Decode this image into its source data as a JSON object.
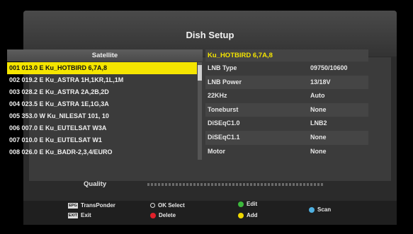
{
  "title": "Dish Setup",
  "satellite_panel": {
    "header": "Satellite",
    "items": [
      {
        "label": "001 013.0 E  Ku_HOTBIRD 6,7A,8",
        "selected": true
      },
      {
        "label": "002 019.2 E  Ku_ASTRA 1H,1KR,1L,1M",
        "selected": false
      },
      {
        "label": "003 028.2 E  Ku_ASTRA 2A,2B,2D",
        "selected": false
      },
      {
        "label": "004 023.5 E  Ku_ASTRA 1E,1G,3A",
        "selected": false
      },
      {
        "label": "005 353.0 W  Ku_NILESAT 101, 10",
        "selected": false
      },
      {
        "label": "006 007.0 E  Ku_EUTELSAT W3A",
        "selected": false
      },
      {
        "label": "007 010.0 E  Ku_EUTELSAT W1",
        "selected": false
      },
      {
        "label": "008 026.0 E  Ku_BADR-2,3,4/EURO",
        "selected": false
      }
    ]
  },
  "info_panel": {
    "selected_name": "Ku_HOTBIRD 6,7A,8",
    "rows": [
      {
        "label": "LNB Type",
        "value": "09750/10600"
      },
      {
        "label": "LNB Power",
        "value": "13/18V"
      },
      {
        "label": "22KHz",
        "value": "Auto"
      },
      {
        "label": "Toneburst",
        "value": "None"
      },
      {
        "label": "DiSEqC1.0",
        "value": "LNB2"
      },
      {
        "label": "DiSEqC1.1",
        "value": "None"
      },
      {
        "label": "Motor",
        "value": "None"
      }
    ]
  },
  "quality": {
    "label": "Quality"
  },
  "footer": {
    "transponder": {
      "key": "EPG",
      "label": "TransPonder"
    },
    "exit": {
      "key": "EXIT",
      "label": "Exit"
    },
    "ok_select": {
      "label": "OK Select"
    },
    "delete": {
      "label": "Delete",
      "color": "#e0202a"
    },
    "edit": {
      "label": "Edit",
      "color": "#3cb83c"
    },
    "add": {
      "label": "Add",
      "color": "#f0d800"
    },
    "scan": {
      "label": "Scan",
      "color": "#4fb0e0"
    }
  }
}
